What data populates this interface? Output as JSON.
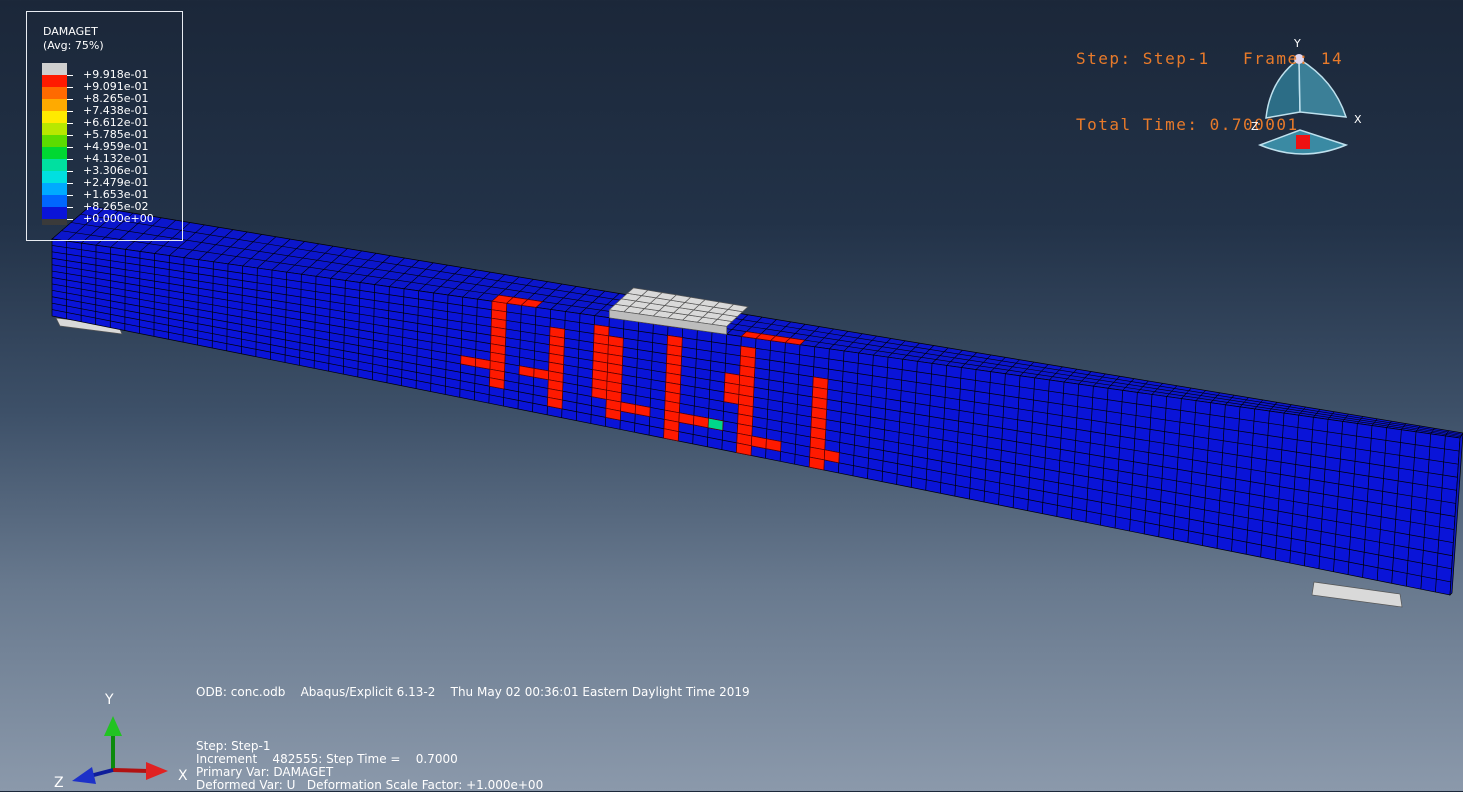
{
  "legend": {
    "title": "DAMAGET",
    "subtitle": "(Avg: 75%)",
    "entries": [
      {
        "label": "+9.918e-01",
        "color": "#cfcfcf"
      },
      {
        "label": "+9.091e-01",
        "color": "#ff1a00"
      },
      {
        "label": "+8.265e-01",
        "color": "#ff6a00"
      },
      {
        "label": "+7.438e-01",
        "color": "#ffaa00"
      },
      {
        "label": "+6.612e-01",
        "color": "#ffea00"
      },
      {
        "label": "+5.785e-01",
        "color": "#b8e800"
      },
      {
        "label": "+4.959e-01",
        "color": "#5cdc00"
      },
      {
        "label": "+4.132e-01",
        "color": "#00d832"
      },
      {
        "label": "+3.306e-01",
        "color": "#00e0a0"
      },
      {
        "label": "+2.479e-01",
        "color": "#00e0e0"
      },
      {
        "label": "+1.653e-01",
        "color": "#00aaff"
      },
      {
        "label": "+8.265e-02",
        "color": "#0066ff"
      },
      {
        "label": "+0.000e+00",
        "color": "#0a14d8"
      }
    ],
    "bottom_color": "#3a3a3a"
  },
  "status": {
    "line1": "Step: Step-1   Frame: 14",
    "line2": "Total Time: 0.700001"
  },
  "info": {
    "line1": "ODB: conc.odb    Abaqus/Explicit 6.13-2    Thu May 02 00:36:01 Eastern Daylight Time 2019",
    "line2": "Step: Step-1",
    "line3": "Increment    482555: Step Time =    0.7000",
    "line4": "Primary Var: DAMAGET",
    "line5": "Deformed Var: U   Deformation Scale Factor: +1.000e+00"
  },
  "triad": {
    "x": "X",
    "y": "Y",
    "z": "Z"
  },
  "view_cube": {
    "x": "X",
    "y": "Y",
    "z": "Z"
  },
  "colors": {
    "beam_face": "#0a14d8",
    "beam_top": "#0b16cc",
    "beam_grid": "#000000",
    "crack": "#ff1a00",
    "crack_edge": "#5a0000",
    "green_element": "#00d88a",
    "pad": "#d9d9d9",
    "status_text": "#e87a2a"
  }
}
